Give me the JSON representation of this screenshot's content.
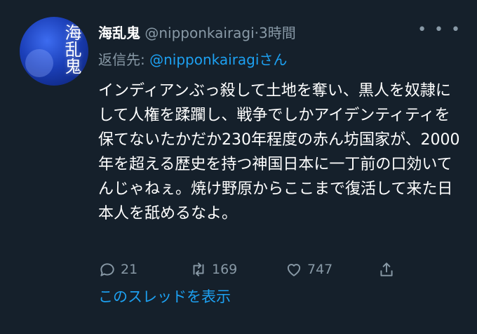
{
  "tweet": {
    "display_name": "海乱鬼",
    "handle": "@nipponkairagi",
    "separator": "·",
    "time": "3時間",
    "reply_label": "返信先: ",
    "reply_handle": "@nipponkairagiさん",
    "avatar_text": "海乱鬼",
    "body": "インディアンぶっ殺して土地を奪い、黒人を奴隷にして人権を蹂躙し、戦争でしかアイデンティティを保てないたかだか230年程度の赤ん坊国家が、2000年を超える歴史を持つ神国日本に一丁前の口効いてんじゃねぇ。焼け野原からここまで復活して来た日本人を舐めるなよ。"
  },
  "actions": {
    "reply_count": "21",
    "retweet_count": "169",
    "like_count": "747"
  },
  "show_thread": "このスレッドを表示",
  "colors": {
    "background": "#15202b",
    "secondary_text": "#8899a6",
    "accent": "#1da1f2"
  }
}
